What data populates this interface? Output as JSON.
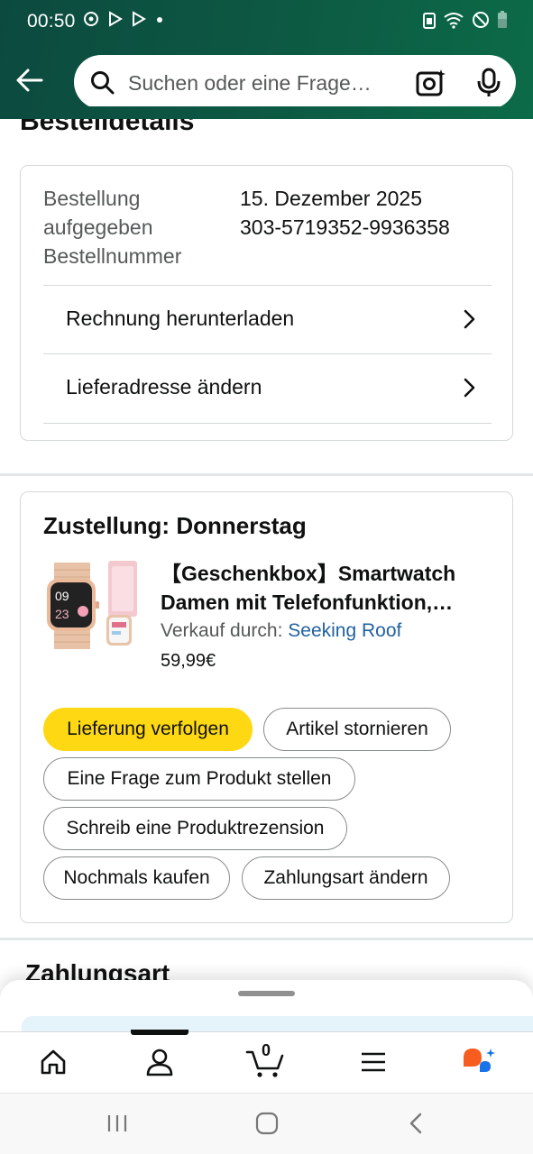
{
  "status_bar": {
    "time": "00:50",
    "left_icons": [
      "sync-icon",
      "play-store-icon",
      "play-store-icon",
      "dot-icon"
    ],
    "right_icons": [
      "data-saver-icon",
      "wifi-icon",
      "dnd-icon",
      "battery-icon"
    ]
  },
  "header": {
    "search_placeholder": "Suchen oder eine Frage…",
    "background": "#0d5a43"
  },
  "page_title": "Bestelldetails",
  "order_details": {
    "labels": [
      "Bestellung aufgegeben",
      "Bestellnummer"
    ],
    "order_date": "15. Dezember 2025",
    "order_number": "303-5719352-9936358",
    "links": [
      {
        "label": "Rechnung herunterladen"
      },
      {
        "label": "Lieferadresse ändern"
      }
    ]
  },
  "delivery": {
    "title": "Zustellung: Donnerstag",
    "product": {
      "title_line1": "【Geschenkbox】Smartwatch",
      "title_line2": "Damen mit Telefonfunktion,…",
      "seller_prefix": "Verkauf durch:",
      "seller_name": "Seeking Roof",
      "price": "59,99€",
      "watch_time_hour": "09",
      "watch_time_min": "23"
    },
    "actions": [
      {
        "label": "Lieferung verfolgen",
        "primary": true
      },
      {
        "label": "Artikel stornieren"
      },
      {
        "label": "Eine Frage zum Produkt stellen"
      },
      {
        "label": "Schreib eine Produktrezension"
      },
      {
        "label": "Nochmals kaufen"
      },
      {
        "label": "Zahlungsart ändern"
      }
    ]
  },
  "next_section_title": "Zahlungsart",
  "bottom_nav": {
    "items": [
      "home-icon",
      "account-icon",
      "cart-icon",
      "menu-icon",
      "rufus-icon"
    ],
    "cart_count": "0",
    "active": "account-icon"
  },
  "system_nav": [
    "recents-icon",
    "home-button-icon",
    "back-icon"
  ],
  "colors": {
    "primary_button": "#ffd814",
    "link": "#2162a1",
    "border": "#d5d9d9"
  }
}
